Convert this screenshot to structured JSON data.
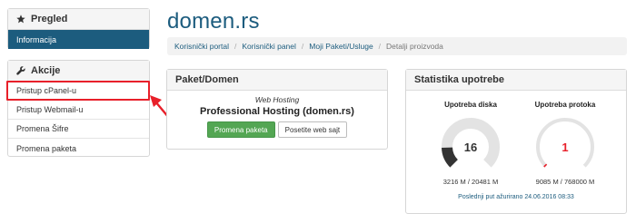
{
  "sidebar": {
    "overview": {
      "title": "Pregled",
      "items": [
        {
          "label": "Informacija"
        }
      ]
    },
    "actions": {
      "title": "Akcije",
      "items": [
        {
          "label": "Pristup cPanel-u"
        },
        {
          "label": "Pristup Webmail-u"
        },
        {
          "label": "Promena Šifre"
        },
        {
          "label": "Promena paketa"
        }
      ]
    }
  },
  "page": {
    "title": "domen.rs"
  },
  "breadcrumb": {
    "items": [
      "Korisnički portal",
      "Korisnički panel",
      "Moji Paketi/Usluge"
    ],
    "current": "Detalji proizvoda"
  },
  "package_panel": {
    "title": "Paket/Domen",
    "type": "Web Hosting",
    "name": "Professional Hosting (domen.rs)",
    "change_button": "Promena paketa",
    "visit_button": "Posetite web sajt"
  },
  "stats_panel": {
    "title": "Statistika upotrebe",
    "disk": {
      "label": "Upotreba diska",
      "value": "16",
      "usage": "3216 M / 20481 M",
      "fraction": 0.16
    },
    "bandwidth": {
      "label": "Upotreba protoka",
      "value": "1",
      "usage": "9085 M / 768000 M",
      "fraction": 0.012
    },
    "updated": "Poslednji put ažurirano 24.06.2016 08:33"
  },
  "colors": {
    "brand": "#1c5c7e",
    "button_green": "#53a653",
    "highlight": "#e8202a",
    "gauge_track": "#e3e3e3",
    "gauge_disk": "#333333",
    "gauge_bandwidth": "#e8202a"
  }
}
